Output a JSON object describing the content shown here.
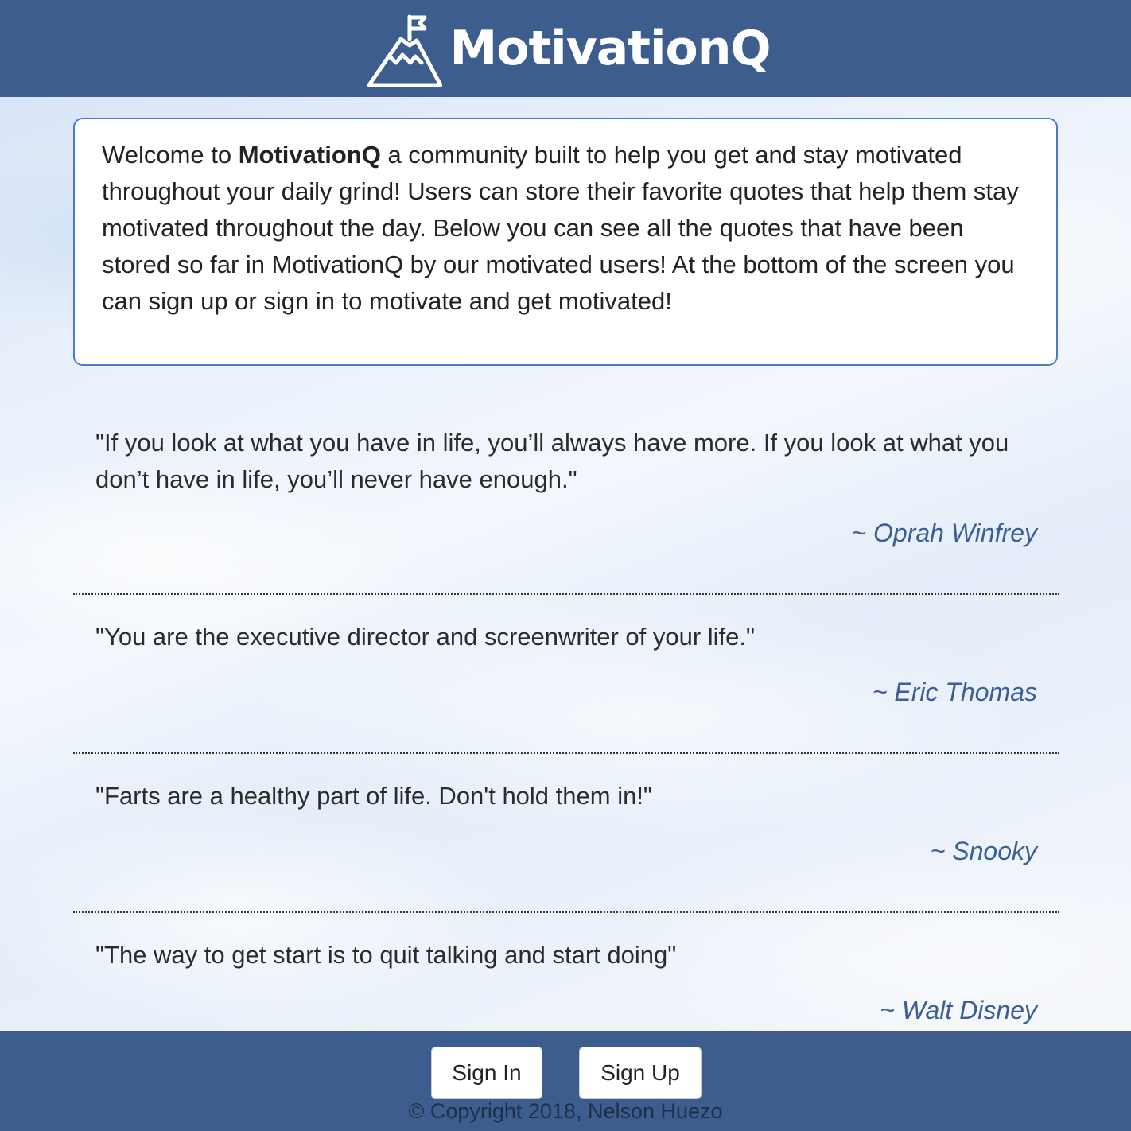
{
  "header": {
    "brand_name": "MotivationQ",
    "logo_icon": "mountain-flag-icon"
  },
  "intro": {
    "lead": "Welcome to ",
    "brand": "MotivationQ",
    "body": " a community built to help you get and stay motivated throughout your daily grind! Users can store their favorite quotes that help them stay motivated throughout the day. Below you can see all the quotes that have been stored so far in MotivationQ by our motivated users! At the bottom of the screen you can sign up or sign in to motivate and get motivated!"
  },
  "quotes": [
    {
      "text": "\"If you look at what you have in life, you’ll always have more. If you look at what you don’t have in life, you’ll never have enough.\"",
      "author": "~ Oprah Winfrey"
    },
    {
      "text": "\"You are the executive director and screenwriter of your life.\"",
      "author": "~ Eric Thomas"
    },
    {
      "text": "\"Farts are a healthy part of life. Don't hold them in!\"",
      "author": "~ Snooky"
    },
    {
      "text": "\"The way to get start is to quit talking and start doing\"",
      "author": "~ Walt Disney"
    }
  ],
  "footer": {
    "sign_in_label": "Sign In",
    "sign_up_label": "Sign Up",
    "copyright": "© Copyright 2018, Nelson Huezo"
  },
  "colors": {
    "brand_blue": "#3c5d8d",
    "author_blue": "#3b5f94",
    "intro_border": "#4a78d6"
  }
}
